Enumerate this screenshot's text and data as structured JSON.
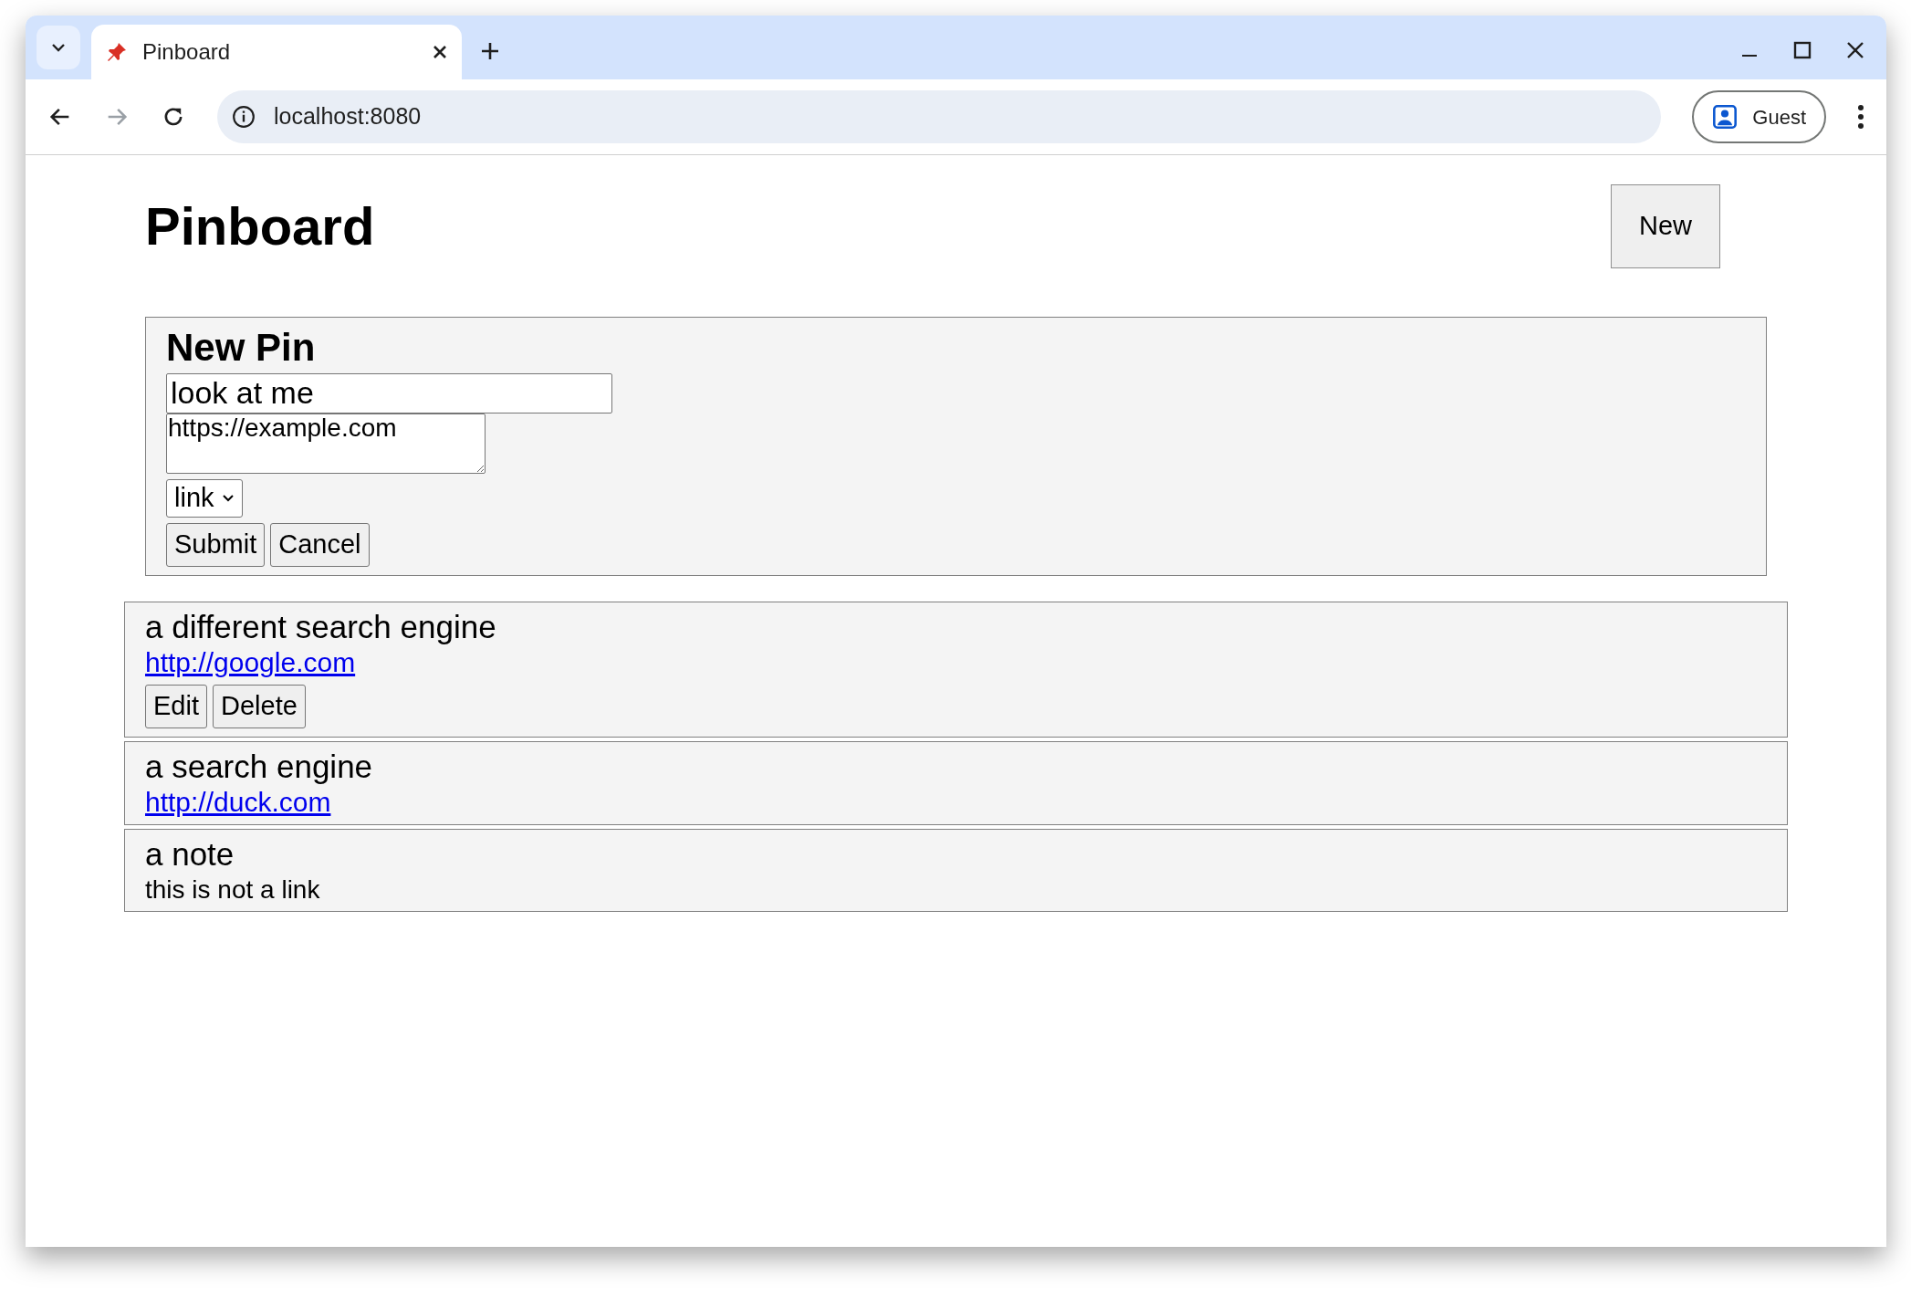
{
  "browser": {
    "tab_title": "Pinboard",
    "url": "localhost:8080",
    "profile": "Guest"
  },
  "page": {
    "title": "Pinboard",
    "new_button": "New"
  },
  "form": {
    "title": "New Pin",
    "title_value": "look at me",
    "url_value": "https://example.com",
    "type_value": "link",
    "buttons": [
      "Submit",
      "Cancel"
    ]
  },
  "pins": [
    {
      "title": "a different search engine",
      "kind": "link",
      "body": "http://google.com",
      "buttons": [
        "Edit",
        "Delete"
      ]
    },
    {
      "title": "a search engine",
      "kind": "link",
      "body": "http://duck.com"
    },
    {
      "title": "a note",
      "kind": "note",
      "body": "this is not a link"
    }
  ]
}
